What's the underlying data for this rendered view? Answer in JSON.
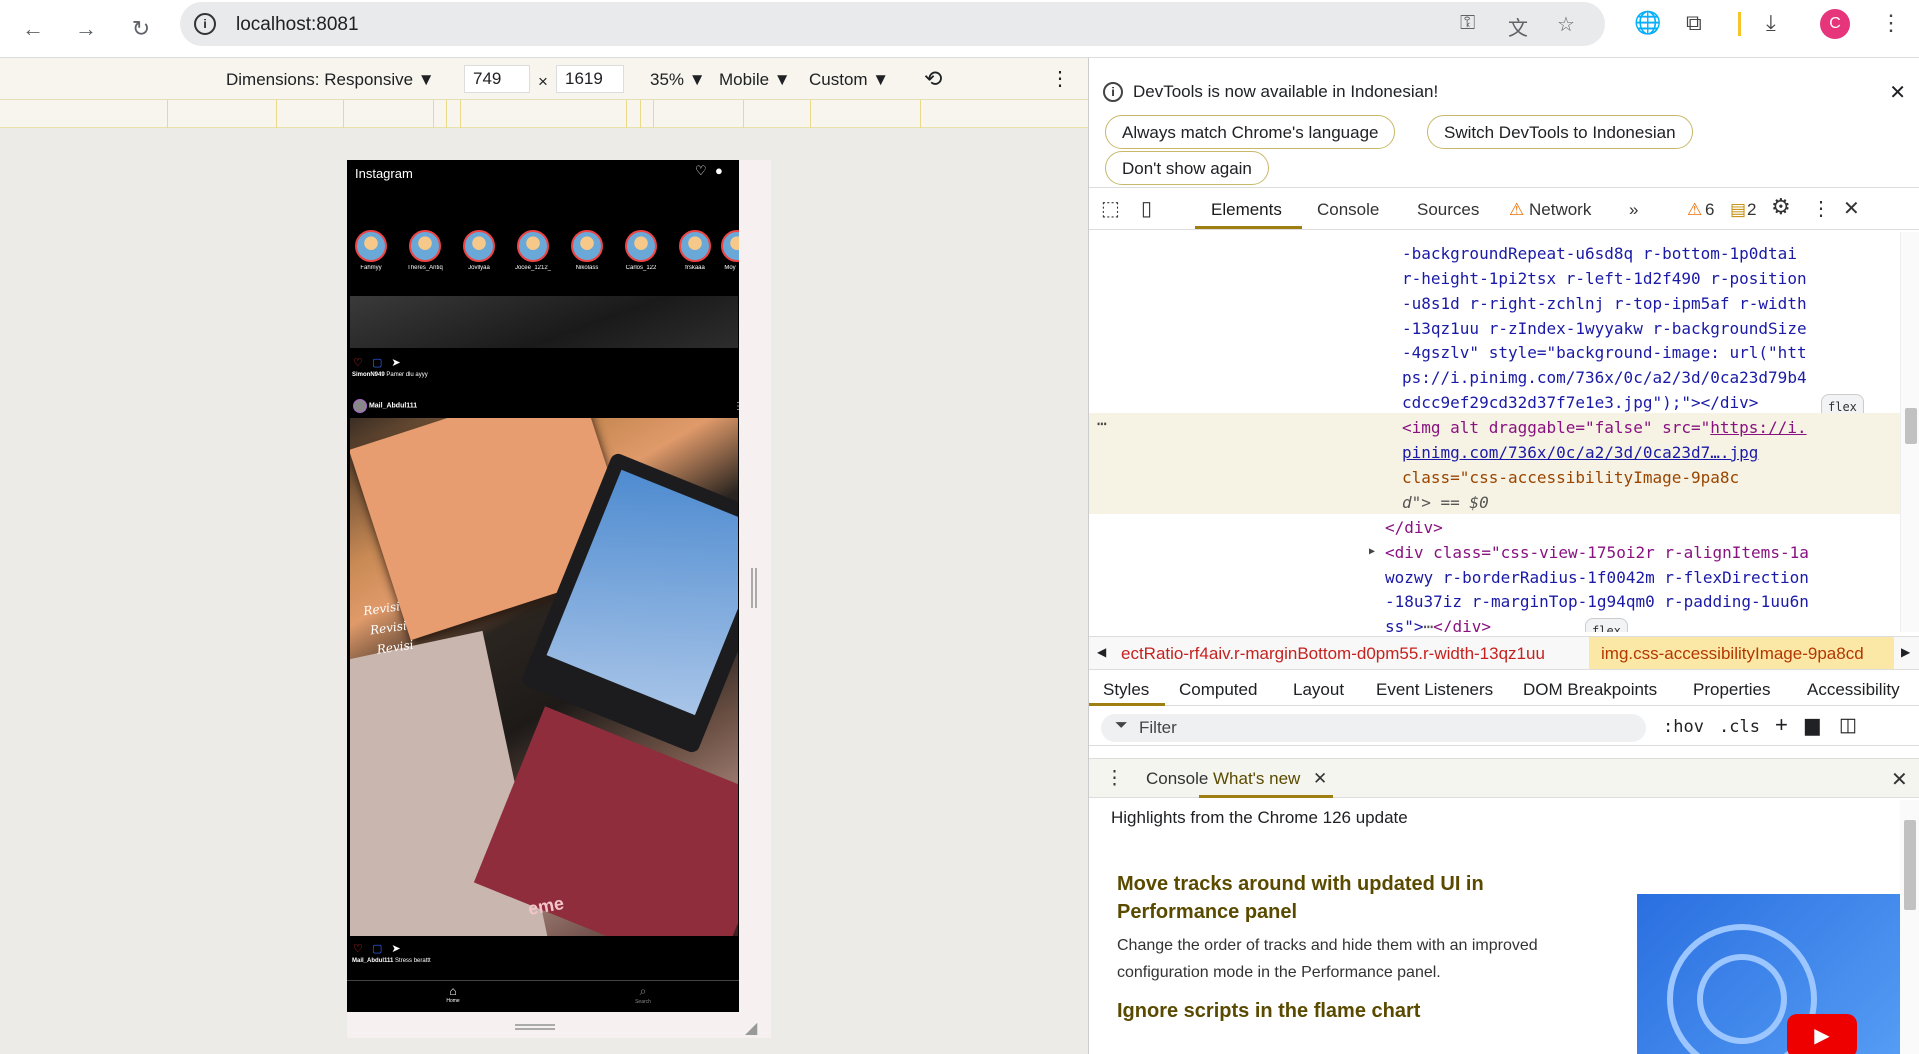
{
  "browser": {
    "url": "localhost:8081",
    "profile_initial": "C"
  },
  "device_toolbar": {
    "dimensions_label": "Dimensions: Responsive ▼",
    "width": "749",
    "times": "×",
    "height": "1619",
    "zoom": "35% ▼",
    "throttle": "Mobile ▼",
    "custom": "Custom ▼"
  },
  "phone": {
    "app_title": "Instagram",
    "stories": [
      "Fahmyy",
      "Theres_Antiq",
      "Jovllyaa",
      "Jocee_1212_",
      "Nikolass",
      "Carlos_122",
      "frskaaa",
      "Moy"
    ],
    "post1": {
      "user": "SimonN949",
      "caption": "Pamer dlu ayyy"
    },
    "post2": {
      "user": "Mail_Abdul111",
      "caption": "Stress berattt",
      "note_lines": [
        "Revisi",
        "Revisi",
        "Revisi"
      ],
      "logo_text": "eme"
    },
    "tabs": [
      "Home",
      "Search"
    ]
  },
  "devtools": {
    "lang_notice": "DevTools is now available in Indonesian!",
    "btn_always_match": "Always match Chrome's language",
    "btn_switch": "Switch DevTools to Indonesian",
    "btn_dont_show": "Don't show again",
    "tabs": [
      "Elements",
      "Console",
      "Sources",
      "Network"
    ],
    "warnings": "6",
    "messages": "2",
    "code_lines": [
      "-backgroundRepeat-u6sd8q r-bottom-1p0dtai",
      "r-height-1pi2tsx r-left-1d2f490 r-position",
      "-u8s1d r-right-zchlnj r-top-ipm5af r-width",
      "-13qz1uu r-zIndex-1wyyakw r-backgroundSize",
      "-4gszlv\" style=\"background-image: url(\"htt",
      "ps://i.pinimg.com/736x/0c/a2/3d/0ca23d79b4",
      "cdcc9ef29cd32d37f7e1e3.jpg\");\"></div>"
    ],
    "img_line1_pre": "<img alt draggable=\"false\" src=\"",
    "img_line1_link": "https://i.",
    "img_line2": "pinimg.com/736x/0c/a2/3d/0ca23d7….jpg",
    "img_line3": "class=\"css-accessibilityImage-9pa8c",
    "img_line4": "d\"> == $0",
    "close_div": "</div>",
    "div_line1": "<div class=\"css-view-175oi2r r-alignItems-1a",
    "div_line2": "wozwy r-borderRadius-1f0042m r-flexDirection",
    "div_line3": "-18u37iz r-marginTop-1g94qm0 r-padding-1uu6n",
    "div_line4": "ss\">",
    "div_line4_end": "</div>",
    "flex_badge": "flex",
    "crumb_left": "ectRatio-rf4aiv.r-marginBottom-d0pm55.r-width-13qz1uu",
    "crumb_right": "img.css-accessibilityImage-9pa8cd",
    "style_tabs": [
      "Styles",
      "Computed",
      "Layout",
      "Event Listeners",
      "DOM Breakpoints",
      "Properties",
      "Accessibility"
    ],
    "filter_placeholder": "Filter",
    "hov": ":hov",
    "cls": ".cls",
    "drawer_tabs": [
      "Console",
      "What's new"
    ],
    "whats_new_header": "Highlights from the Chrome 126 update",
    "article1_title": "Move tracks around with updated UI in Performance panel",
    "article1_body": "Change the order of tracks and hide them with an improved configuration mode in the Performance panel.",
    "article2_title": "Ignore scripts in the flame chart"
  }
}
